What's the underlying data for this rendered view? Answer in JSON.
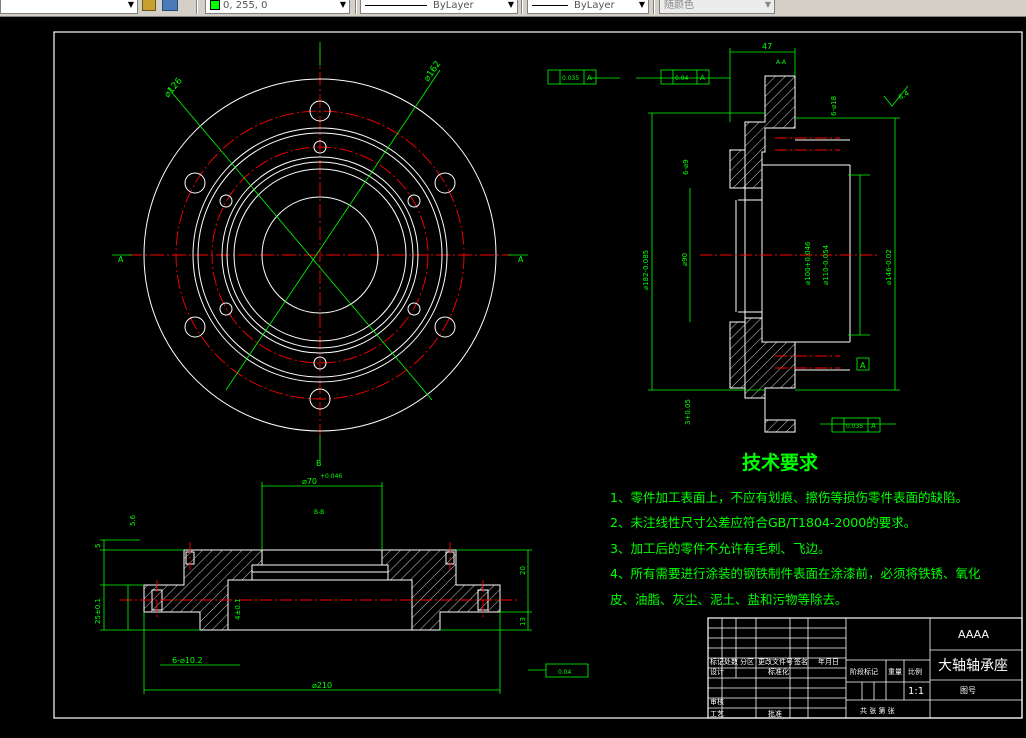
{
  "toolbar": {
    "color_value": "0, 255, 0",
    "linetype": "ByLayer",
    "lineweight": "ByLayer",
    "plotstyle": "随颜色"
  },
  "colors": {
    "background": "#000000",
    "outline": "#ffffff",
    "centerline": "#ff0000",
    "dimension": "#00ff00",
    "hatch": "#ffffff"
  },
  "drawing": {
    "tech_title": "技术要求",
    "requirements": [
      "1、零件加工表面上，不应有划痕、擦伤等损伤零件表面的缺陷。",
      "2、未注线性尺寸公差应符合GB/T1804-2000的要求。",
      "3、加工后的零件不允许有毛刺、飞边。",
      "4、所有需要进行涂装的钢铁制件表面在涂漆前，必须将铁锈、氧化",
      "皮、油脂、灰尘、泥土、盐和污物等除去。"
    ],
    "front_dims": {
      "d1": "⌀126",
      "d2": "⌀162",
      "label_left": "A",
      "label_right": "A",
      "label_bottom": "B"
    },
    "side_dims": {
      "w47": "47",
      "pos_tol": "0.035",
      "perp_tol": "0.04",
      "section": "A-A",
      "d182": "⌀182-0.085",
      "d90": "⌀90",
      "d100": "⌀100+0.046",
      "d110": "⌀110-0.054",
      "d146": "⌀146-0.02",
      "h6_18": "6-⌀18",
      "h6_9": "6-⌀9",
      "r3": "3+0.05",
      "rough": "6.4",
      "datum": "A"
    },
    "bottom_dims": {
      "d70": "⌀70",
      "d70_tol": "+0.046",
      "section": "B-B",
      "d210": "⌀210",
      "h6_10": "6-⌀10.2",
      "h20": "20",
      "h13": "13",
      "h5": "5",
      "h56": "5.6",
      "h251": "25±0.1",
      "h41": "4±0.1",
      "flat_tol": "0.04"
    },
    "title_block": {
      "company": "AAAA",
      "part_name": "大轴轴承座",
      "scale": "1:1",
      "drawing_no": "图号",
      "sheet_info": "共 张 第 张",
      "labels": {
        "mark": "标记",
        "count": "处数",
        "zone": "分区",
        "change_doc": "更改文件号",
        "sign": "签名",
        "date": "年月日",
        "designer": "设计",
        "standard": "标准化",
        "stage": "阶段标记",
        "weight": "重量",
        "ratio": "比例",
        "review": "审核",
        "process": "工艺",
        "approve": "批准"
      }
    }
  }
}
